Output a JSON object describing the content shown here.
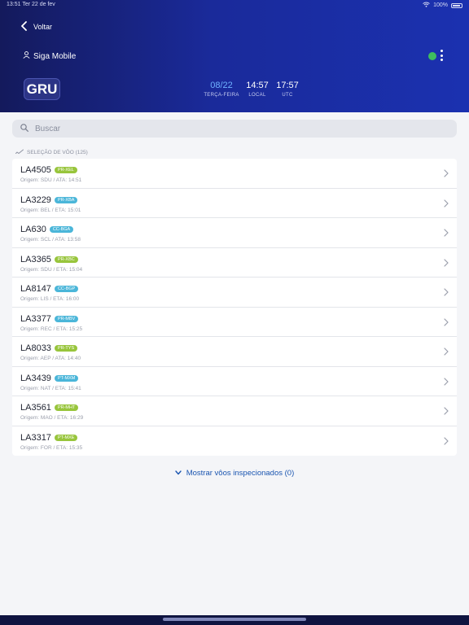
{
  "statusbar": {
    "left": "13:51  Ter 22 de fev",
    "right": "100%"
  },
  "header": {
    "back_label": "Voltar",
    "user_name": "Siga Mobile",
    "airport_code": "GRU",
    "date": {
      "value": "08/22",
      "label": "TERÇA-FEIRA"
    },
    "local": {
      "value": "14:57",
      "label": "LOCAL"
    },
    "utc": {
      "value": "17:57",
      "label": "UTC"
    },
    "status_color": "#3ebd5e"
  },
  "search": {
    "placeholder": "Buscar"
  },
  "section_label": "SELEÇÃO DE VÔO (125)",
  "flights": [
    {
      "flight": "LA4505",
      "reg": "PR-XEL",
      "color": "green",
      "info": "Origem: SDU / ATA: 14:51"
    },
    {
      "flight": "LA3229",
      "reg": "PR-XBA",
      "color": "blue",
      "info": "Origem: BEL / ETA: 15:01"
    },
    {
      "flight": "LA630",
      "reg": "CC-BGA",
      "color": "blue",
      "info": "Origem: SCL / ATA: 13:58"
    },
    {
      "flight": "LA3365",
      "reg": "PR-XBC",
      "color": "green",
      "info": "Origem: SDU / ETA: 15:04"
    },
    {
      "flight": "LA8147",
      "reg": "CC-BGP",
      "color": "blue",
      "info": "Origem: LIS / ETA: 16:00"
    },
    {
      "flight": "LA3377",
      "reg": "PR-MBV",
      "color": "blue",
      "info": "Origem: REC / ETA: 15:25"
    },
    {
      "flight": "LA8033",
      "reg": "PR-TYS",
      "color": "green",
      "info": "Origem: AEP / ATA: 14:40"
    },
    {
      "flight": "LA3439",
      "reg": "PT-MXM",
      "color": "blue",
      "info": "Origem: NAT / ETA: 15:41"
    },
    {
      "flight": "LA3561",
      "reg": "PR-MHT",
      "color": "green",
      "info": "Origem: MAO / ETA: 16:29"
    },
    {
      "flight": "LA3317",
      "reg": "PT-MXE",
      "color": "green",
      "info": "Origem: FOR / ETA: 15:35"
    }
  ],
  "show_inspected_label": "Mostrar vôos inspecionados (0)"
}
